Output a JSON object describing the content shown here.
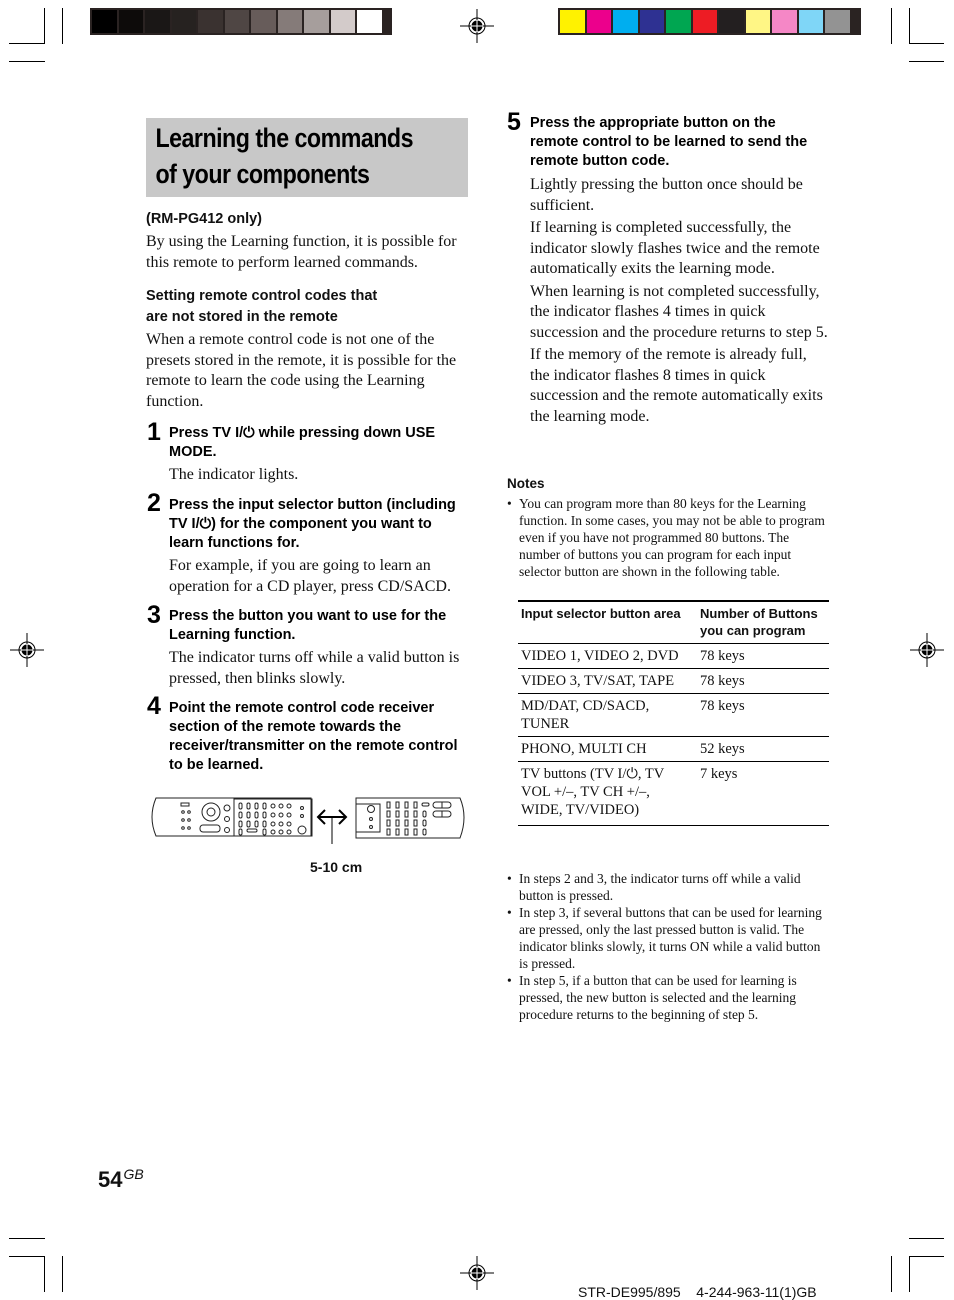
{
  "print_marks": {
    "gray_swatches": [
      "#000000",
      "#0d0b0a",
      "#1a1716",
      "#262220",
      "#3a3230",
      "#4f4644",
      "#675c5a",
      "#857b79",
      "#a69e9c",
      "#d3cbca",
      "#ffffff"
    ],
    "color_swatches": [
      "#fff200",
      "#ec008c",
      "#00aeef",
      "#2e3192",
      "#00a651",
      "#ed1c24",
      "#231f20",
      "#fff685",
      "#f587c6",
      "#7fd6f7",
      "#939393"
    ]
  },
  "title": {
    "line1": "Learning the commands",
    "line2": "of your components"
  },
  "intro": {
    "model_note": "(RM-PG412 only)",
    "text": "By using the Learning function, it is possible for this remote to perform learned commands."
  },
  "section": {
    "heading_line1": "Setting remote control codes that",
    "heading_line2": "are not stored in the remote",
    "text": "When a remote control code is not one of the presets stored in the remote, it is possible for the remote to learn the code using the Learning function."
  },
  "steps": [
    {
      "number": "1",
      "heading": "Press TV I/⏻ while pressing down USE MODE.",
      "body": [
        "The indicator lights."
      ]
    },
    {
      "number": "2",
      "heading": "Press the input selector button (including  TV I/⏻) for the component you want to learn functions for.",
      "body": [
        "For example, if you are going to learn an operation for a CD player, press CD/SACD."
      ]
    },
    {
      "number": "3",
      "heading": "Press the button you want to use for the Learning function.",
      "body": [
        "The indicator turns off while a valid button is pressed, then blinks slowly."
      ]
    },
    {
      "number": "4",
      "heading": "Point the remote control code receiver section of the remote towards the receiver/transmitter on the remote control to be learned.",
      "body": []
    },
    {
      "number": "5",
      "heading": "Press the appropriate button on the remote control to be learned to send the remote button code.",
      "body": [
        "Lightly pressing the button once should be sufficient.",
        "If learning is completed successfully, the indicator slowly flashes twice and the remote automatically exits the learning mode.",
        "When learning is not completed successfully, the indicator flashes 4 times in quick succession and the procedure returns to step 5.",
        "If the memory of the remote is already full, the indicator flashes 8 times in quick succession and the remote automatically exits the learning mode."
      ]
    }
  ],
  "illustration": {
    "distance_label": "5-10 cm"
  },
  "notes": {
    "heading": "Notes",
    "first": "You can program more than 80 keys for the Learning function. In some cases, you may not be able to program even if you have not programmed 80 buttons. The number of buttons you can program for each input selector button are shown in the following table.",
    "table": {
      "headers": [
        "Input selector button area",
        "Number of Buttons you can program"
      ],
      "rows": [
        [
          "VIDEO 1, VIDEO 2, DVD",
          "78 keys"
        ],
        [
          "VIDEO 3, TV/SAT, TAPE",
          "78 keys"
        ],
        [
          "MD/DAT, CD/SACD, TUNER",
          "78 keys"
        ],
        [
          "PHONO, MULTI CH",
          "52 keys"
        ],
        [
          "TV buttons (TV I/⏻, TV VOL +/–, TV CH +/–, WIDE, TV/VIDEO)",
          "7 keys"
        ]
      ]
    },
    "more": [
      "In steps 2 and 3, the indicator turns off while a valid button is pressed.",
      "In step 3, if several buttons that can be used for learning are pressed, only the last pressed button is valid. The indicator blinks slowly, it turns ON while a valid button is pressed.",
      "In step 5, if a button that can be used for learning is pressed, the new button is selected and the learning procedure returns to the beginning of step 5."
    ]
  },
  "footer": {
    "page_number": "54",
    "page_suffix": "GB",
    "model_code": "STR-DE995/895    4-244-963-11(1)GB"
  }
}
